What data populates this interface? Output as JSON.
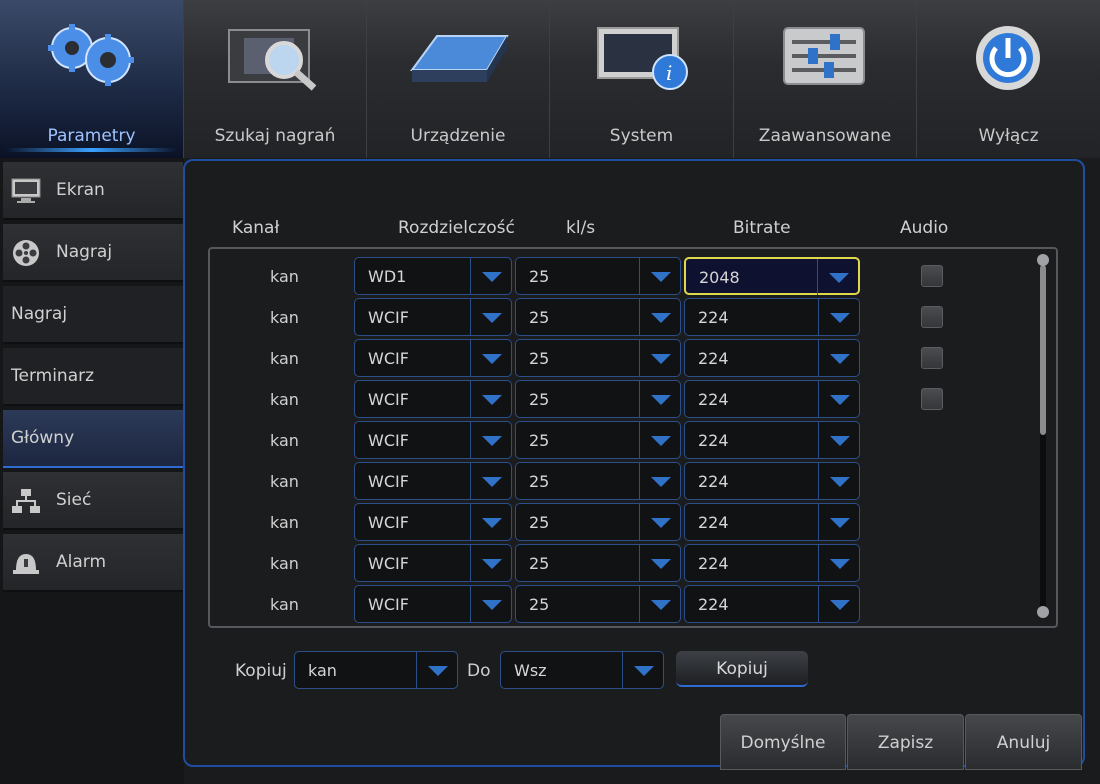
{
  "top_menu": {
    "items": [
      {
        "label": "Parametry",
        "icon": "gears-icon"
      },
      {
        "label": "Szukaj nagrań",
        "icon": "film-search-icon"
      },
      {
        "label": "Urządzenie",
        "icon": "hard-drive-icon"
      },
      {
        "label": "System",
        "icon": "monitor-info-icon"
      },
      {
        "label": "Zaawansowane",
        "icon": "sliders-icon"
      },
      {
        "label": "Wyłącz",
        "icon": "power-icon"
      }
    ]
  },
  "sidebar": {
    "items": [
      {
        "label": "Ekran",
        "icon": "monitor-icon"
      },
      {
        "label": "Nagraj",
        "icon": "film-reel-icon"
      },
      {
        "label": "Nagraj"
      },
      {
        "label": "Terminarz"
      },
      {
        "label": "Główny"
      },
      {
        "label": "Sieć",
        "icon": "network-icon"
      },
      {
        "label": "Alarm",
        "icon": "alarm-bell-icon"
      }
    ]
  },
  "table": {
    "headers": {
      "kanal": "Kanał",
      "resolution": "Rozdzielczość",
      "fps": "kl/s",
      "bitrate": "Bitrate",
      "audio": "Audio"
    },
    "rows": [
      {
        "kanal": "kan",
        "resolution": "WD1",
        "fps": "25",
        "bitrate": "2048"
      },
      {
        "kanal": "kan",
        "resolution": "WCIF",
        "fps": "25",
        "bitrate": "224"
      },
      {
        "kanal": "kan",
        "resolution": "WCIF",
        "fps": "25",
        "bitrate": "224"
      },
      {
        "kanal": "kan",
        "resolution": "WCIF",
        "fps": "25",
        "bitrate": "224"
      },
      {
        "kanal": "kan",
        "resolution": "WCIF",
        "fps": "25",
        "bitrate": "224"
      },
      {
        "kanal": "kan",
        "resolution": "WCIF",
        "fps": "25",
        "bitrate": "224"
      },
      {
        "kanal": "kan",
        "resolution": "WCIF",
        "fps": "25",
        "bitrate": "224"
      },
      {
        "kanal": "kan",
        "resolution": "WCIF",
        "fps": "25",
        "bitrate": "224"
      },
      {
        "kanal": "kan",
        "resolution": "WCIF",
        "fps": "25",
        "bitrate": "224"
      }
    ]
  },
  "copy": {
    "label": "Kopiuj",
    "from_value": "kan",
    "to_label": "Do",
    "to_value": "Wsz",
    "button": "Kopiuj"
  },
  "buttons": {
    "default": "Domyślne",
    "save": "Zapisz",
    "cancel": "Anuluj"
  },
  "colors": {
    "accent": "#2f72c8",
    "selection": "#e0d84a",
    "panel_border": "#1f4e9e"
  }
}
